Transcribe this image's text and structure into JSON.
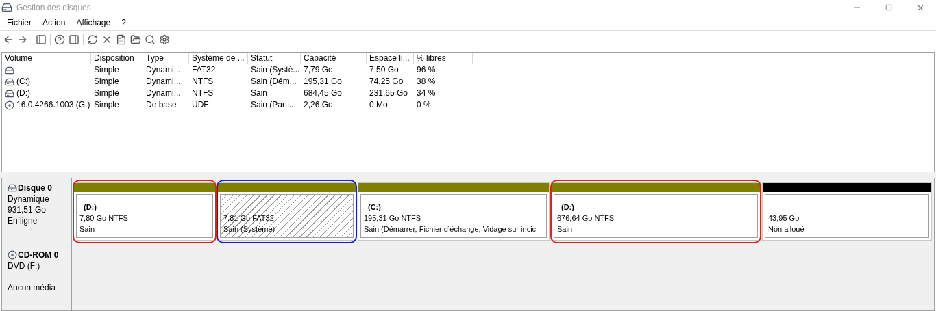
{
  "window": {
    "title": "Gestion des disques"
  },
  "menu": [
    "Fichier",
    "Action",
    "Affichage",
    "?"
  ],
  "table": {
    "columns": [
      "Volume",
      "Disposition",
      "Type",
      "Système de ...",
      "Statut",
      "Capacité",
      "Espace li...",
      "% libres"
    ],
    "rows": [
      {
        "kind": "disk",
        "cells": [
          "",
          "Simple",
          "Dynami...",
          "FAT32",
          "Sain (Systè...",
          "7,79 Go",
          "7,50 Go",
          "96 %"
        ]
      },
      {
        "kind": "disk",
        "cells": [
          "(C:)",
          "Simple",
          "Dynami...",
          "NTFS",
          "Sain (Dém...",
          "195,31 Go",
          "74,25 Go",
          "38 %"
        ]
      },
      {
        "kind": "disk",
        "cells": [
          "(D:)",
          "Simple",
          "Dynami...",
          "NTFS",
          "Sain",
          "684,45 Go",
          "231,65 Go",
          "34 %"
        ]
      },
      {
        "kind": "cd",
        "cells": [
          "16.0.4266.1003 (G:)",
          "Simple",
          "De base",
          "UDF",
          "Sain (Parti...",
          "2,26 Go",
          "0 Mo",
          "0 %"
        ]
      }
    ]
  },
  "disks": [
    {
      "kind": "disk",
      "name": "Disque 0",
      "lines": [
        "Dynamique",
        "931,51 Go",
        "En ligne"
      ],
      "partitions": [
        {
          "kind": "volume",
          "label": "(D:)",
          "size": "7,80 Go NTFS",
          "status": "Sain",
          "color": "#e02020"
        },
        {
          "kind": "system",
          "size": "7,81 Go FAT32",
          "status": "Sain (Système)",
          "color": "#1a1ae0"
        },
        {
          "kind": "volume",
          "label": "(C:)",
          "size": "195,31 Go NTFS",
          "status": "Sain (Démarrer, Fichier d’échange, Vidage sur incic"
        },
        {
          "kind": "volume",
          "label": "(D:)",
          "size": "676,64 Go NTFS",
          "status": "Sain",
          "color": "#e02020"
        },
        {
          "kind": "unallocated",
          "size": "43,95 Go",
          "status": "Non alloué"
        }
      ]
    },
    {
      "kind": "cd",
      "name": "CD-ROM 0",
      "lines": [
        "DVD (F:)",
        "Aucun média"
      ]
    }
  ]
}
